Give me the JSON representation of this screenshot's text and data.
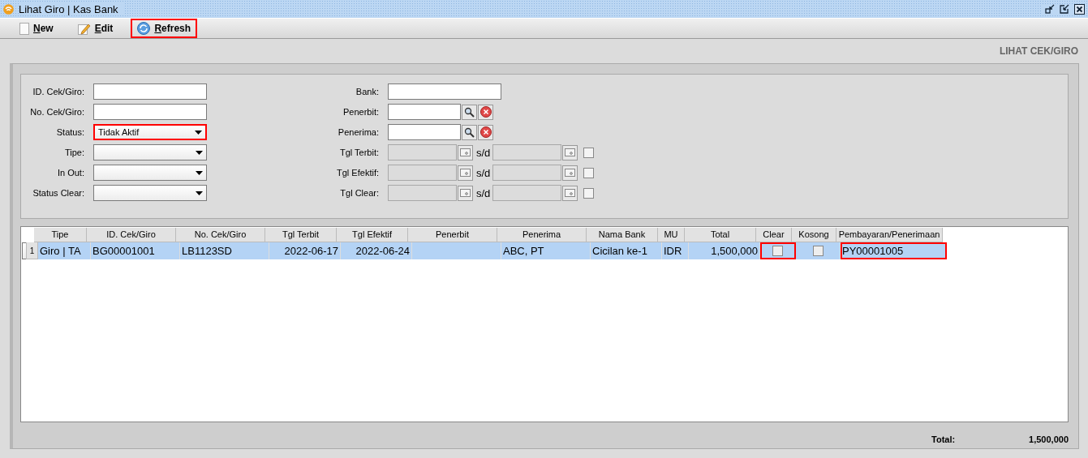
{
  "window": {
    "title": "Lihat Giro | Kas Bank"
  },
  "toolbar": [
    {
      "label": "New",
      "highlighted": false
    },
    {
      "label": "Edit",
      "highlighted": false
    },
    {
      "label": "Refresh",
      "highlighted": true
    }
  ],
  "page_title": "LIHAT CEK/GIRO",
  "filters_left": [
    {
      "label": "ID. Cek/Giro:",
      "kind": "text"
    },
    {
      "label": "No. Cek/Giro:",
      "kind": "text"
    },
    {
      "label": "Status:",
      "kind": "select",
      "value": "Tidak Aktif",
      "highlighted": true
    },
    {
      "label": "Tipe:",
      "kind": "select"
    },
    {
      "label": "In Out:",
      "kind": "select"
    },
    {
      "label": "Status Clear:",
      "kind": "select"
    }
  ],
  "filters_right": [
    {
      "label": "Bank:",
      "kind": "text"
    },
    {
      "label": "Penerbit:",
      "kind": "lookup"
    },
    {
      "label": "Penerima:",
      "kind": "lookup"
    },
    {
      "label": "Tgl Terbit:",
      "kind": "daterange",
      "separator": "s/d",
      "checked": false
    },
    {
      "label": "Tgl Efektif:",
      "kind": "daterange",
      "separator": "s/d",
      "checked": false
    },
    {
      "label": "Tgl Clear:",
      "kind": "daterange",
      "separator": "s/d",
      "checked": false
    }
  ],
  "table": {
    "columns": [
      "Tipe",
      "ID. Cek/Giro",
      "No. Cek/Giro",
      "Tgl Terbit",
      "Tgl Efektif",
      "Penerbit",
      "Penerima",
      "Nama Bank",
      "MU",
      "Total",
      "Clear",
      "Kosong",
      "Pembayaran/Penerimaan"
    ],
    "rows": [
      {
        "number": "1",
        "selected": true,
        "cells": [
          {
            "kind": "text",
            "text": "Giro | TA"
          },
          {
            "kind": "text",
            "text": "BG00001001"
          },
          {
            "kind": "text",
            "text": "LB1123SD"
          },
          {
            "kind": "date",
            "text": "2022-06-17"
          },
          {
            "kind": "date",
            "text": "2022-06-24"
          },
          {
            "kind": "text"
          },
          {
            "kind": "text",
            "text": "ABC, PT"
          },
          {
            "kind": "text",
            "text": "Cicilan ke-1"
          },
          {
            "kind": "text",
            "text": "IDR"
          },
          {
            "kind": "number",
            "text": "1,500,000"
          },
          {
            "kind": "checkbox",
            "checked": false,
            "highlighted": true
          },
          {
            "kind": "checkbox",
            "checked": false
          },
          {
            "kind": "text",
            "text": "PY00001005",
            "highlighted": true
          }
        ]
      }
    ]
  },
  "footer": {
    "label": "Total:",
    "value": "1,500,000"
  }
}
